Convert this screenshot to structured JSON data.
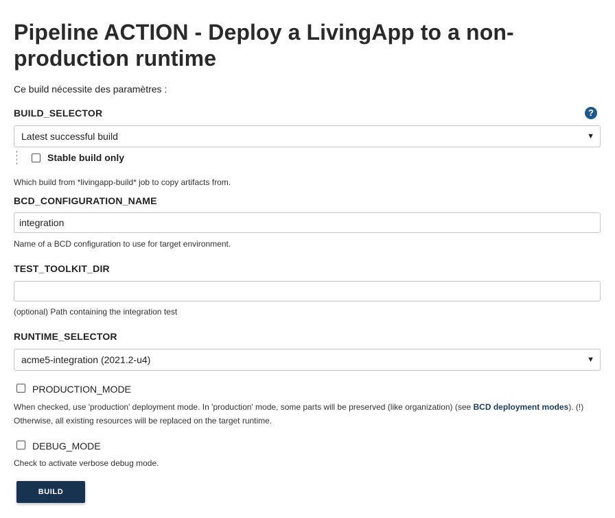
{
  "title": "Pipeline ACTION - Deploy a LivingApp to a non-production runtime",
  "intro": "Ce build nécessite des paramètres :",
  "build_selector": {
    "label": "BUILD_SELECTOR",
    "help_icon": "?",
    "selected": "Latest successful build",
    "stable_only_label": "Stable build only",
    "stable_only_checked": false,
    "description": "Which build from *livingapp-build* job to copy artifacts from."
  },
  "bcd_configuration": {
    "label": "BCD_CONFIGURATION_NAME",
    "value": "integration",
    "description": "Name of a BCD configuration to use for target environment."
  },
  "test_toolkit": {
    "label": "TEST_TOOLKIT_DIR",
    "value": "",
    "description": "(optional) Path containing the integration test"
  },
  "runtime_selector": {
    "label": "RUNTIME_SELECTOR",
    "selected": "acme5-integration (2021.2-u4)"
  },
  "production_mode": {
    "label": "PRODUCTION_MODE",
    "checked": false,
    "description_before": "When checked, use 'production' deployment mode. In 'production' mode, some parts will be preserved (like organization) (see ",
    "link_text": "BCD deployment modes",
    "description_after": "). (!)",
    "description_line2": "Otherwise, all existing resources will be replaced on the target runtime."
  },
  "debug_mode": {
    "label": "DEBUG_MODE",
    "checked": false,
    "description": "Check to activate verbose debug mode."
  },
  "build_button_label": "BUILD",
  "colors": {
    "primary_button": "#173350",
    "help_icon": "#1d5a8c",
    "link": "#1a3c5c"
  }
}
